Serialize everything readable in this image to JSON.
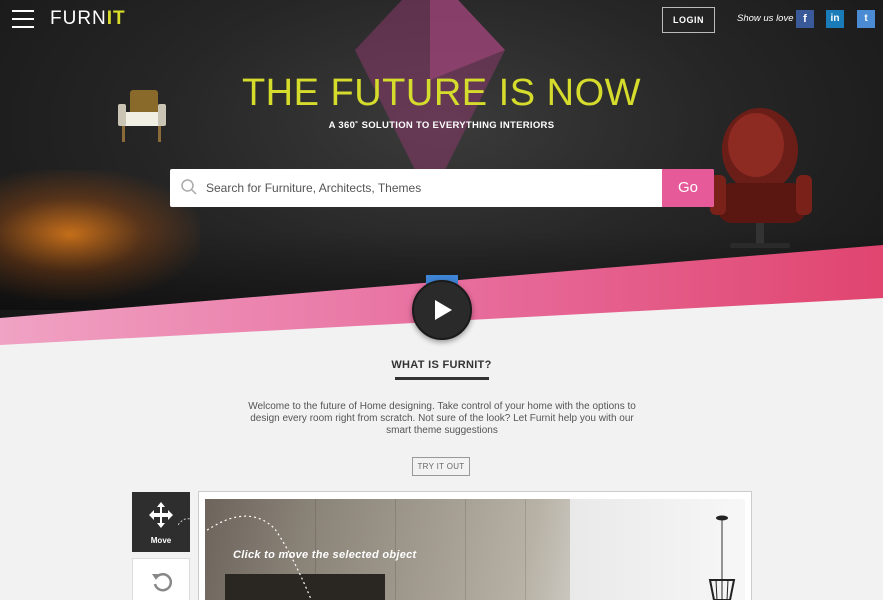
{
  "header": {
    "logo_light": "FURN",
    "logo_bold": "IT",
    "login_label": "LOGIN",
    "show_love_text": "Show us love",
    "social": [
      {
        "name": "facebook",
        "glyph": "f",
        "color": "#3a5998"
      },
      {
        "name": "linkedin",
        "glyph": "in",
        "color": "#1a7bb9"
      },
      {
        "name": "twitter",
        "glyph": "t",
        "color": "#4a8bd4"
      }
    ]
  },
  "hero": {
    "headline": "THE FUTURE IS NOW",
    "subheadline": "A 360˚ SOLUTION TO EVERYTHING INTERIORS",
    "search_placeholder": "Search for Furniture, Architects, Themes",
    "go_label": "Go",
    "accent_color": "#d6dc2c",
    "go_color": "#e65a9a"
  },
  "about": {
    "title": "WHAT IS FURNIT?",
    "description": "Welcome to the future of Home designing. Take control of your home with the options to design every room right from scratch. Not sure of the look? Let Furnit help you with our smart theme suggestions",
    "try_label": "TRY IT OUT"
  },
  "tools": {
    "move_label": "Move",
    "demo_caption": "Click to move the selected object"
  },
  "icons": [
    "menu-icon",
    "search-icon",
    "play-icon",
    "move-icon",
    "rotate-icon"
  ]
}
